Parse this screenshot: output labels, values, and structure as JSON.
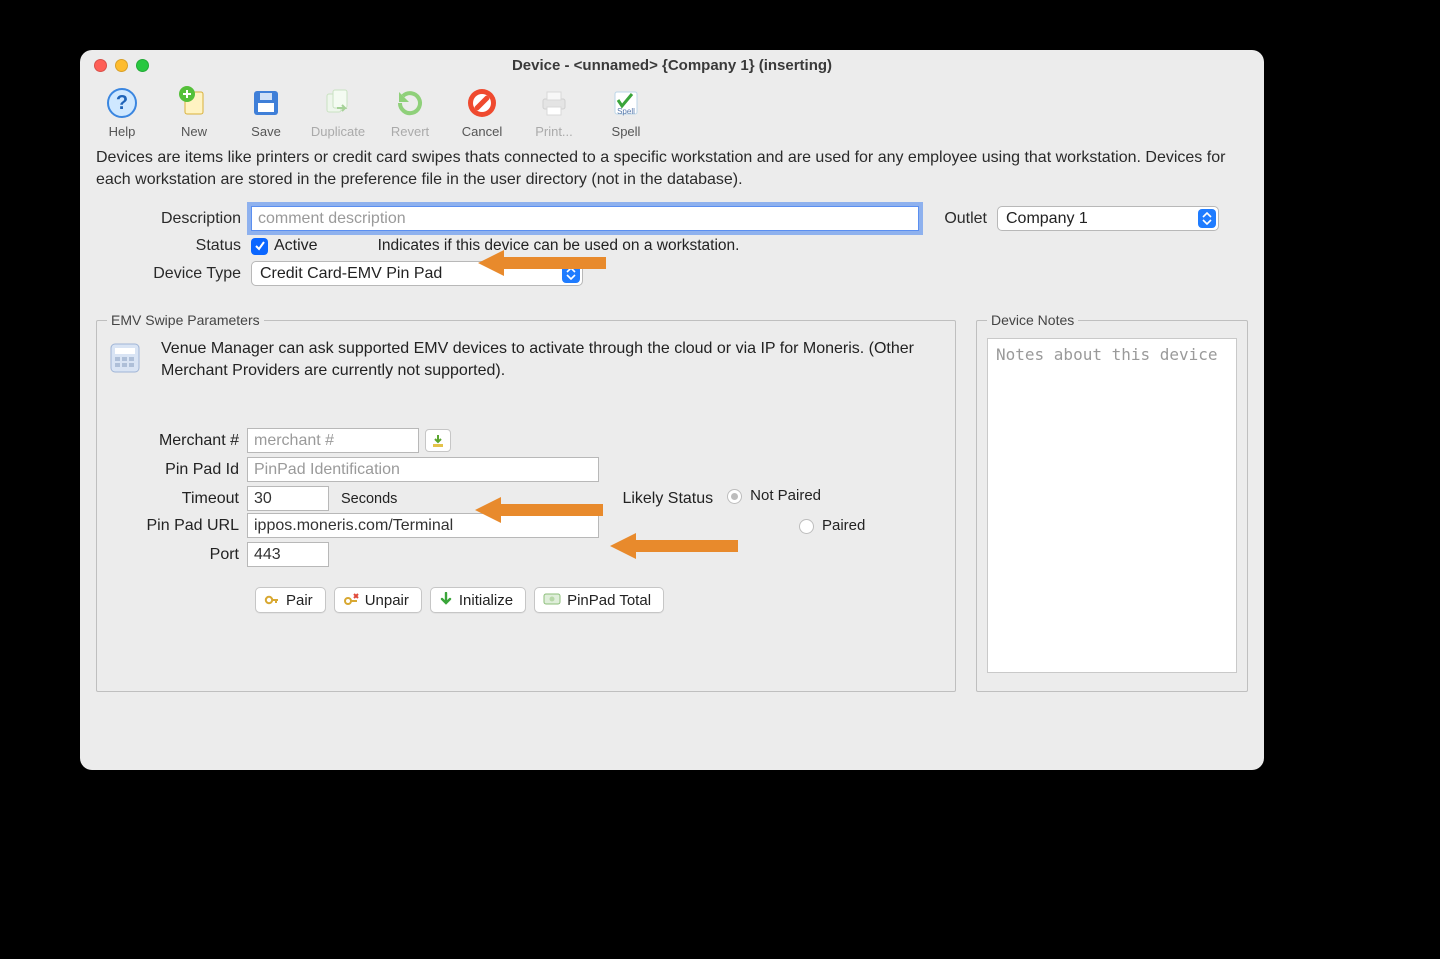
{
  "window": {
    "title": "Device - <unnamed> {Company 1} (inserting)"
  },
  "toolbar": {
    "help": {
      "label": "Help"
    },
    "new": {
      "label": "New"
    },
    "save": {
      "label": "Save"
    },
    "dup": {
      "label": "Duplicate"
    },
    "revert": {
      "label": "Revert"
    },
    "cancel": {
      "label": "Cancel"
    },
    "print": {
      "label": "Print..."
    },
    "spell": {
      "label": "Spell"
    }
  },
  "intro": "Devices are items like printers or credit card swipes thats connected to a specific workstation and are used for any employee using that workstation.  Devices for each workstation are stored in the preference file in the user directory (not in the database).",
  "fields": {
    "description": {
      "label": "Description",
      "placeholder": "comment description",
      "value": ""
    },
    "outlet": {
      "label": "Outlet",
      "value": "Company 1"
    },
    "status": {
      "label": "Status",
      "checkbox_label": "Active",
      "checked": true,
      "hint": "Indicates if this device can be used on a workstation."
    },
    "device_type": {
      "label": "Device Type",
      "value": "Credit Card-EMV Pin Pad"
    }
  },
  "emv": {
    "legend": "EMV Swipe Parameters",
    "desc": "Venue Manager can ask supported EMV devices to activate through the cloud or via IP for Moneris.  (Other Merchant Providers are currently not supported).",
    "merchant": {
      "label": "Merchant #",
      "placeholder": "merchant #",
      "value": ""
    },
    "pinpad_id": {
      "label": "Pin Pad Id",
      "placeholder": "PinPad Identification",
      "value": ""
    },
    "timeout": {
      "label": "Timeout",
      "value": "30",
      "unit": "Seconds"
    },
    "likely": {
      "label": "Likely Status",
      "not_paired": "Not Paired",
      "paired": "Paired",
      "selected": "not_paired"
    },
    "url": {
      "label": "Pin Pad URL",
      "value": "ippos.moneris.com/Terminal"
    },
    "port": {
      "label": "Port",
      "value": "443"
    },
    "buttons": {
      "pair": "Pair",
      "unpair": "Unpair",
      "initialize": "Initialize",
      "pinpad_total": "PinPad Total"
    }
  },
  "notes": {
    "legend": "Device Notes",
    "placeholder": "Notes about this device"
  }
}
